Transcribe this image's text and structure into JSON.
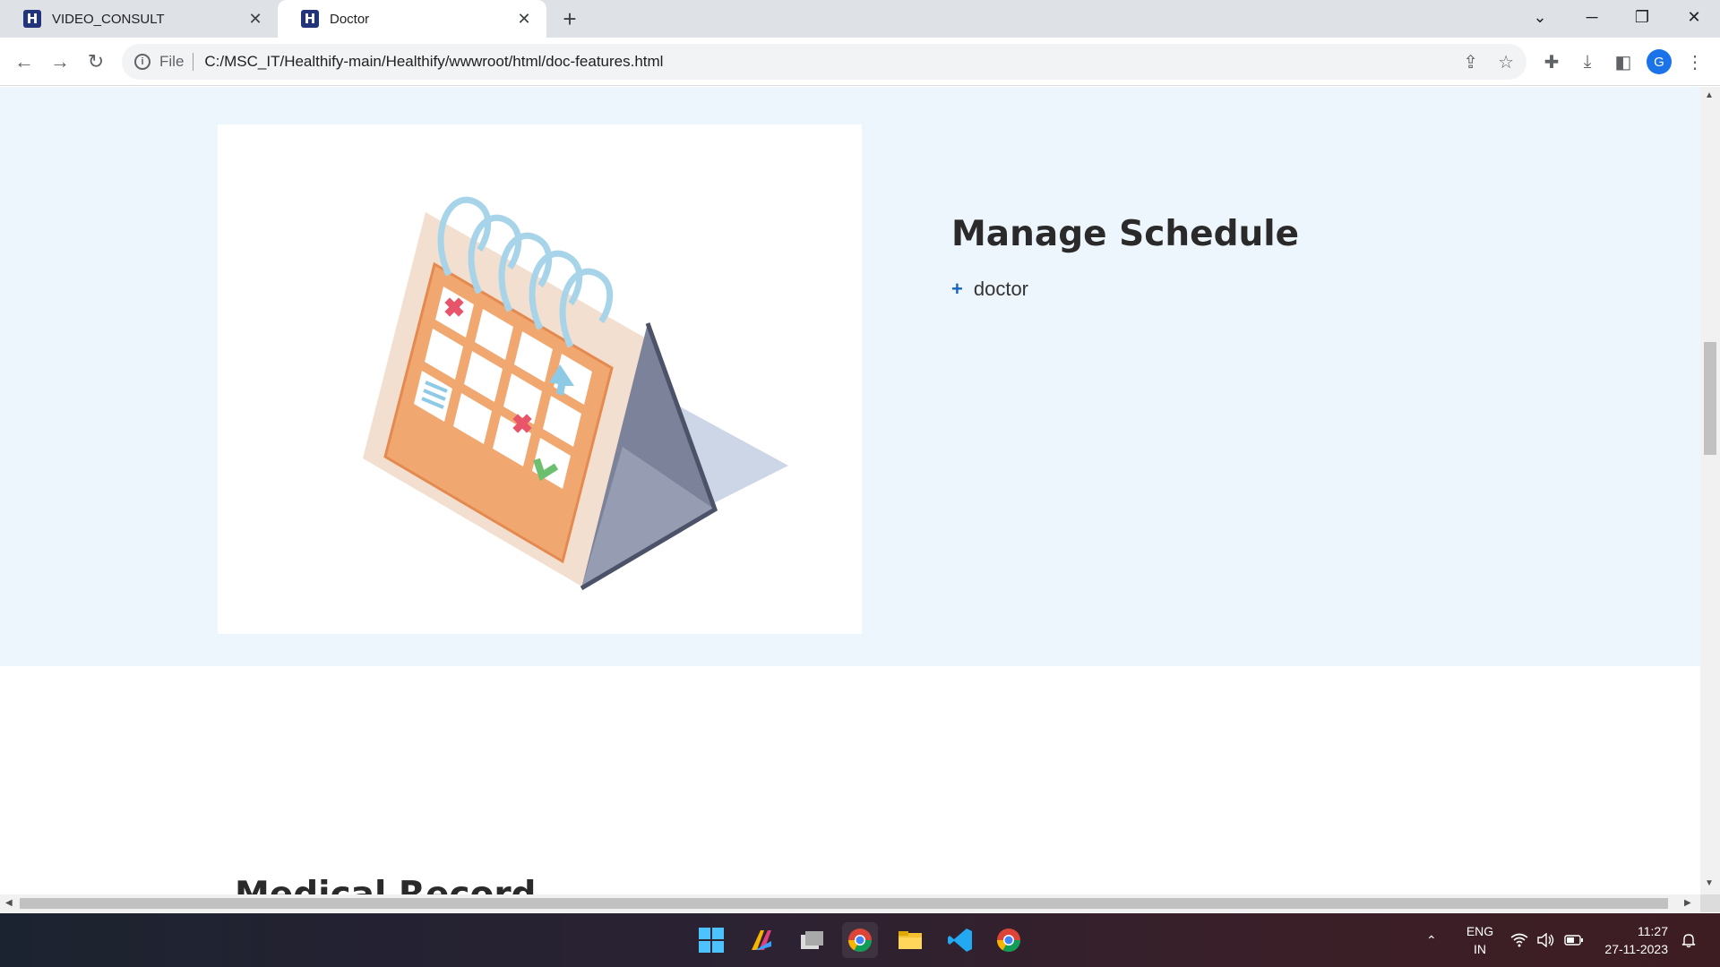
{
  "browser": {
    "tabs": [
      {
        "label": "VIDEO_CONSULT",
        "favicon": "H",
        "active": false
      },
      {
        "label": "Doctor",
        "favicon": "H",
        "active": true
      }
    ],
    "new_tab_symbol": "+",
    "address": {
      "scheme_label": "File",
      "url": "C:/MSC_IT/Healthify-main/Healthify/wwwroot/html/doc-features.html"
    },
    "profile_initial": "G"
  },
  "page": {
    "feature": {
      "title": "Manage Schedule",
      "items": [
        "doctor"
      ],
      "image_alt": "calendar-illustration"
    },
    "next_section_title": "Medical Record"
  },
  "taskbar": {
    "language": {
      "line1": "ENG",
      "line2": "IN"
    },
    "time": "11:27",
    "date": "27-11-2023"
  },
  "colors": {
    "section_bg": "#eef6fd",
    "accent": "#1565c0",
    "favicon": "#22347a"
  }
}
